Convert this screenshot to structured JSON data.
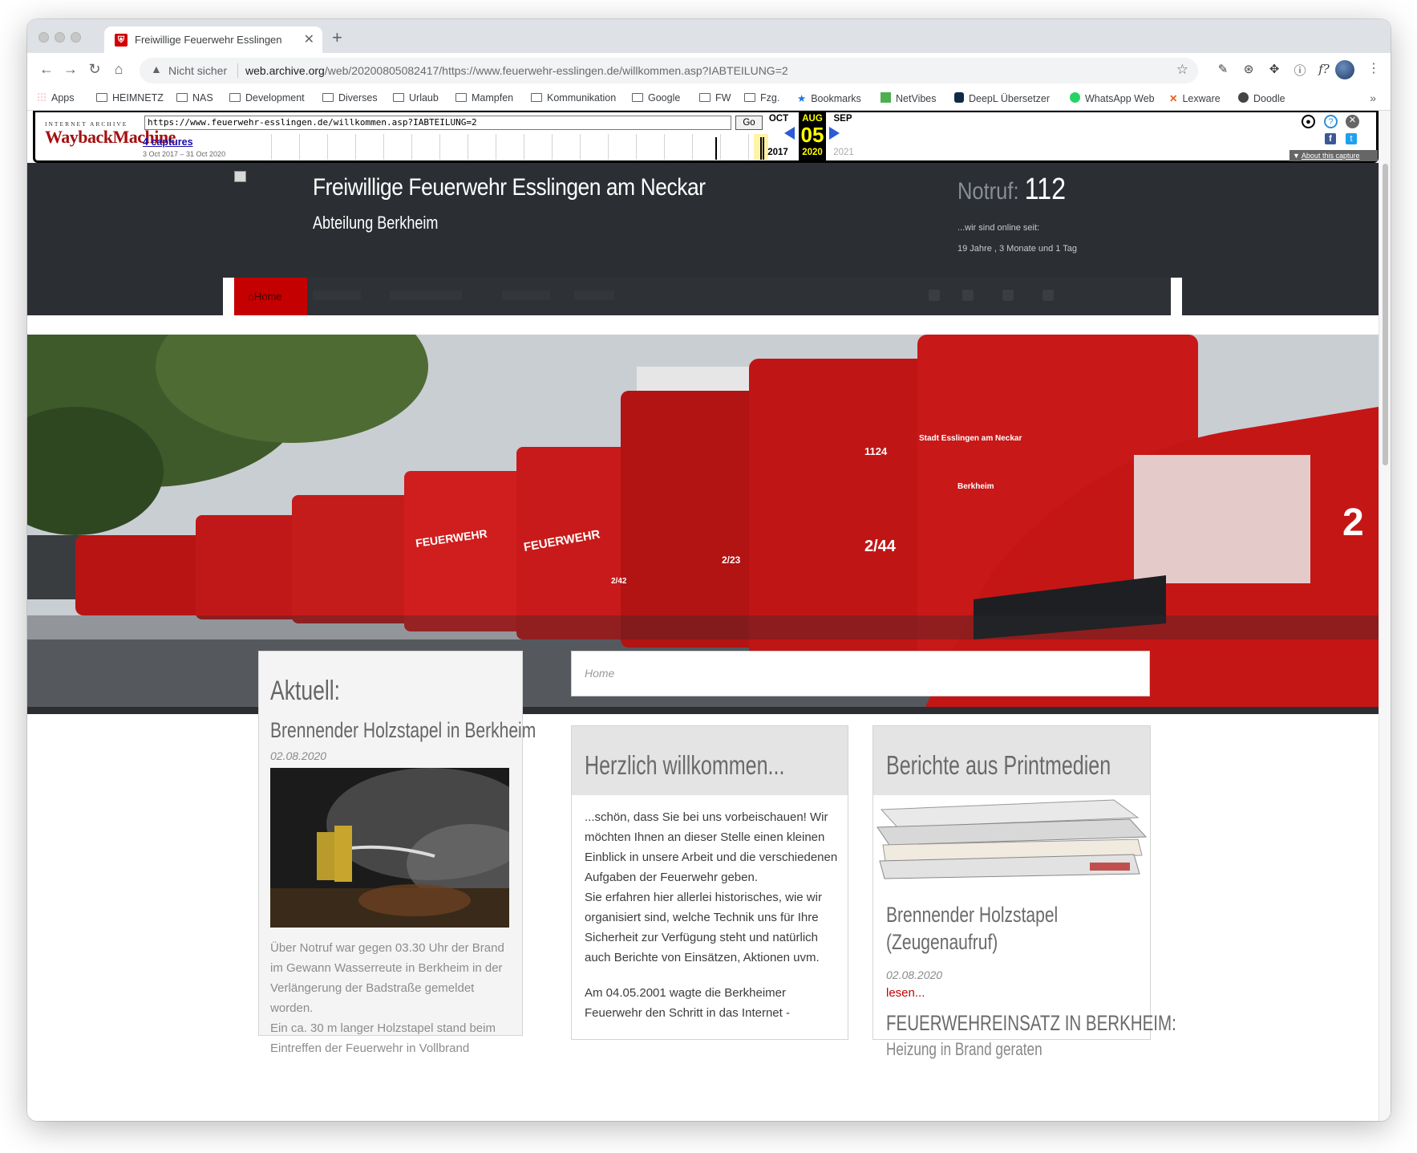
{
  "browser": {
    "tab_title": "Freiwillige Feuerwehr Esslingen",
    "new_tab_symbol": "+",
    "close_symbol": "✕",
    "security_label": "Nicht sicher",
    "url_host": "web.archive.org",
    "url_path": "/web/20200805082417/https://www.feuerwehr-esslingen.de/willkommen.asp?IABTEILUNG=2"
  },
  "bookmarks": [
    "Apps",
    "HEIMNETZ",
    "NAS",
    "Development",
    "Diverses",
    "Urlaub",
    "Mampfen",
    "Kommunikation",
    "Google",
    "FW",
    "Fzg.",
    "Bookmarks",
    "NetVibes",
    "DeepL Übersetzer",
    "WhatsApp Web",
    "Lexware",
    "Doodle"
  ],
  "wayback": {
    "logo_top": "INTERNET ARCHIVE",
    "logo_main": "WaybackMachine",
    "url_value": "https://www.feuerwehr-esslingen.de/willkommen.asp?IABTEILUNG=2",
    "go_label": "Go",
    "captures_label": "4 captures",
    "range_label": "3 Oct 2017 – 31 Oct 2020",
    "prev_month": "OCT",
    "prev_year": "2017",
    "cur_month": "AUG",
    "cur_day": "05",
    "cur_year": "2020",
    "next_month": "SEP",
    "next_year": "2021",
    "about_label": "About this capture"
  },
  "site": {
    "title": "Freiwillige Feuerwehr Esslingen am Neckar",
    "subtitle": "Abteilung Berkheim",
    "emergency_label": "Notruf:",
    "emergency_number": "112",
    "online_since_label": "...wir sind online seit:",
    "online_duration": "19 Jahre , 3 Monate und 1 Tag",
    "nav_home": "Home"
  },
  "sidebar": {
    "heading": "Aktuell:",
    "article_title": "Brennender Holzstapel in Berkheim",
    "article_date": "02.08.2020",
    "article_text_1": "Über Notruf war gegen 03.30 Uhr der Brand im Gewann Wasserreute in Berkheim in der Verlängerung der Badstraße gemeldet worden.",
    "article_text_2": "Ein ca. 30 m langer Holzstapel stand beim Eintreffen der Feuerwehr in Vollbrand"
  },
  "breadcrumb": "Home",
  "welcome": {
    "heading": "Herzlich willkommen...",
    "para_1": "...schön, dass Sie bei uns vorbeischauen! Wir möchten Ihnen an dieser Stelle einen kleinen Einblick in unsere Arbeit und die verschiedenen Aufgaben der Feuerwehr geben.",
    "para_2": "Sie erfahren hier allerlei historisches, wie wir organisiert sind, welche Technik uns für Ihre Sicherheit zur Verfügung steht und natürlich auch Berichte von Einsätzen, Aktionen uvm.",
    "para_3": "Am 04.05.2001 wagte die Berkheimer Feuerwehr den Schritt in das Internet -"
  },
  "reports": {
    "heading": "Berichte aus Printmedien",
    "item1_title_line1": "Brennender Holzstapel",
    "item1_title_line2": "(Zeugenaufruf)",
    "item1_date": "02.08.2020",
    "item1_link": "lesen...",
    "item2_title": "FEUERWEHREINSATZ IN BERKHEIM:",
    "item2_sub": "Heizung in Brand geraten"
  },
  "hero_image_text": {
    "truck_plate_1": "1124",
    "door_text_1": "Stadt Esslingen am Neckar",
    "door_text_2": "Berkheim",
    "truck_label_1": "2/44",
    "truck_label_2": "2/23",
    "truck_label_3": "2/42",
    "truck_label_4": "2",
    "truck_lettering": "FEUERWEHR"
  },
  "colors": {
    "header_bg": "#2b2f34",
    "accent_red": "#c40000",
    "wayback_yellow": "#ffff00"
  }
}
